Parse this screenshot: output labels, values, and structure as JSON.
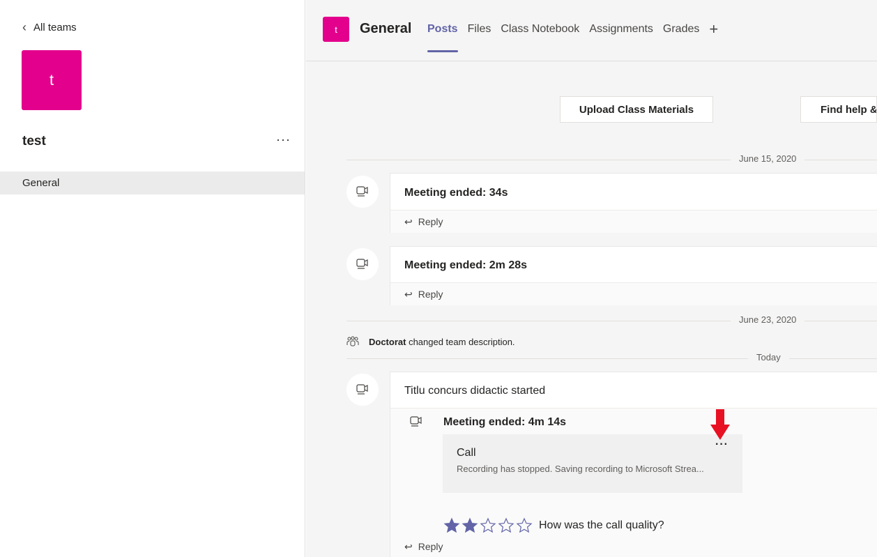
{
  "sidebar": {
    "back_label": "All teams",
    "team_initial": "t",
    "team_name": "test",
    "team_more": "···",
    "channels": [
      {
        "label": "General"
      }
    ]
  },
  "header": {
    "channel_initial": "t",
    "channel_name": "General",
    "tabs": [
      {
        "label": "Posts",
        "active": true
      },
      {
        "label": "Files"
      },
      {
        "label": "Class Notebook"
      },
      {
        "label": "Assignments"
      },
      {
        "label": "Grades"
      }
    ],
    "add_tab": "+"
  },
  "actions": {
    "upload_label": "Upload Class Materials",
    "help_label": "Find help &"
  },
  "dates": {
    "d1": "June 15, 2020",
    "d2": "June 23, 2020",
    "d3": "Today"
  },
  "posts": [
    {
      "title": "Meeting ended: 34s",
      "reply": "Reply"
    },
    {
      "title": "Meeting ended: 2m 28s",
      "reply": "Reply"
    }
  ],
  "system_message": {
    "actor": "Doctorat",
    "text": " changed team description."
  },
  "meeting_post": {
    "title": "Titlu concurs didactic started",
    "sub_title": "Meeting ended: 4m 14s",
    "call_title": "Call",
    "call_status": "Recording has stopped. Saving recording to Microsoft Strea...",
    "call_more": "···",
    "rating_filled": 2,
    "rating_max": 5,
    "quality_prompt": "How was the call quality?",
    "reply": "Reply"
  },
  "colors": {
    "team_accent": "#e3008c",
    "brand": "#6264a7",
    "annotation_arrow": "#e81123"
  }
}
